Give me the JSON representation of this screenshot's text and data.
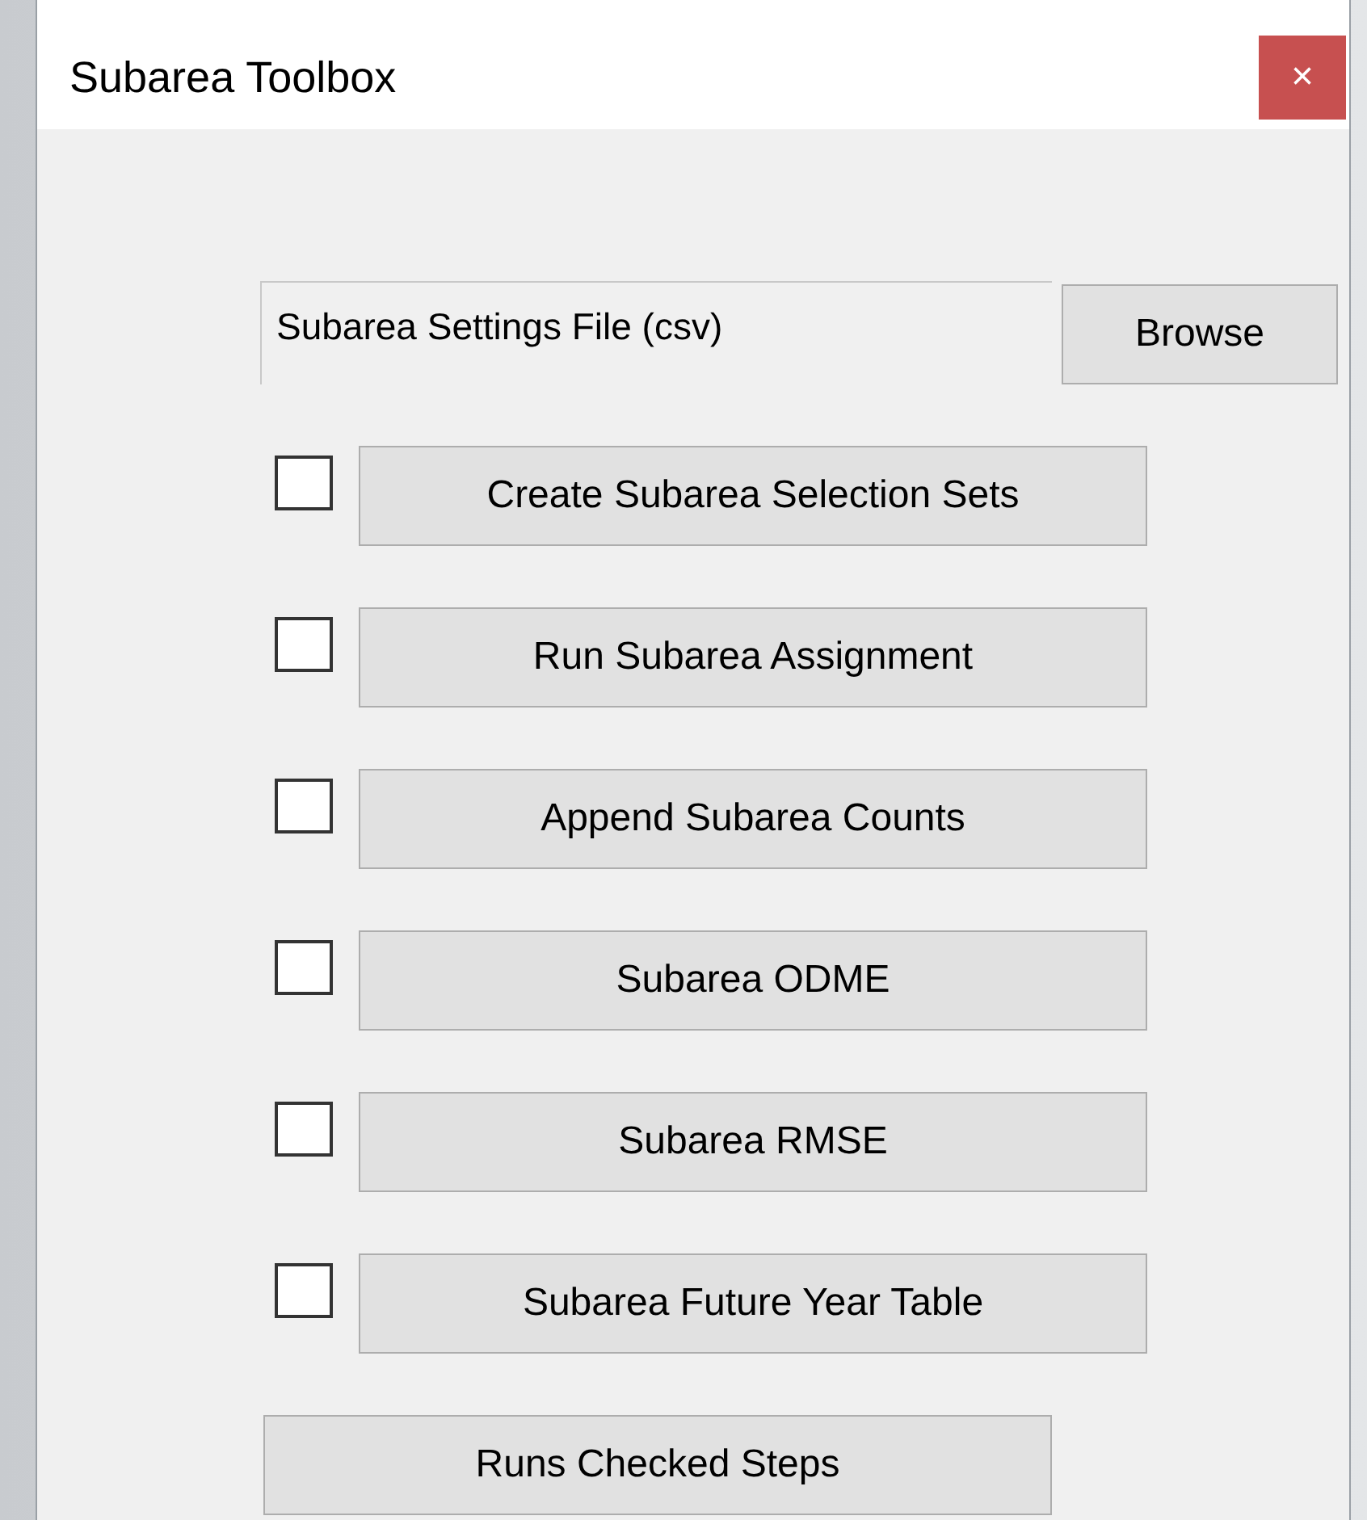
{
  "window": {
    "title": "Subarea Toolbox",
    "close": "×"
  },
  "settings_file": {
    "value": "Subarea Settings File (csv)",
    "browse": "Browse"
  },
  "steps": [
    {
      "label": "Create Subarea Selection Sets",
      "checked": false
    },
    {
      "label": "Run Subarea Assignment",
      "checked": false
    },
    {
      "label": "Append Subarea Counts",
      "checked": false
    },
    {
      "label": "Subarea ODME",
      "checked": false
    },
    {
      "label": "Subarea RMSE",
      "checked": false
    },
    {
      "label": "Subarea Future Year Table",
      "checked": false
    }
  ],
  "run_button": "Runs Checked Steps"
}
